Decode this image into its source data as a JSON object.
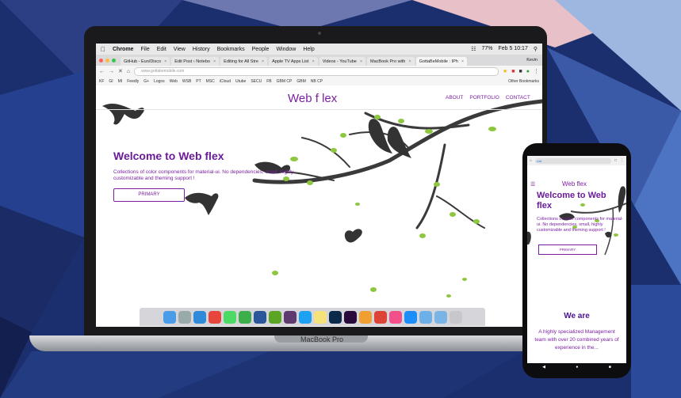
{
  "colors": {
    "brand": "#7b1fa2",
    "dark_purple": "#6a1b9a",
    "background": "#1b2f6e"
  },
  "laptop_label": "MacBook Pro",
  "menubar": {
    "items": [
      "Chrome",
      "File",
      "Edit",
      "View",
      "History",
      "Bookmarks",
      "People",
      "Window",
      "Help"
    ],
    "battery": "77%",
    "clock": "Feb 5  10:17"
  },
  "browser": {
    "tabs": [
      "GitHub - Eun/Disco",
      "Edit Post ‹ Notebo",
      "Editing for All Stre",
      "Apple TV Apps List",
      "Videos - YouTube",
      "MacBook Pro with",
      "GottaBeMobile : IPh"
    ],
    "profile": "Kevin",
    "url": "www.gottabemobile.com",
    "bookmarks": [
      "KF",
      "GI",
      "MI",
      "Feedly",
      "G+",
      "Logos",
      "Web",
      "WSB",
      "PT",
      "MSC",
      "iCloud",
      "Utube",
      "SECU",
      "FB",
      "GBM CP",
      "GBM",
      "NB CP"
    ],
    "other_bookmarks": "Other Bookmarks"
  },
  "site": {
    "logo": "Web f lex",
    "nav": [
      "ABOUT",
      "PORTFOLIO",
      "CONTACT"
    ],
    "welcome": "Welcome to Web flex",
    "description": "Collections of color components for material-ui. No dependencies, small, highly customizable and theming support !",
    "primary_button": "PRIMARY"
  },
  "phone": {
    "url": "Lite",
    "logo": "Web flex",
    "welcome": "Welcome to Web flex",
    "description": "Collections of color components for material-ui. No dependencies, small, highly customizable and theming support !",
    "primary_button": "PRIMARY",
    "we_are": "We are",
    "about_text": "A highly specialized Management team with over 20 combined years of experience in the..."
  }
}
